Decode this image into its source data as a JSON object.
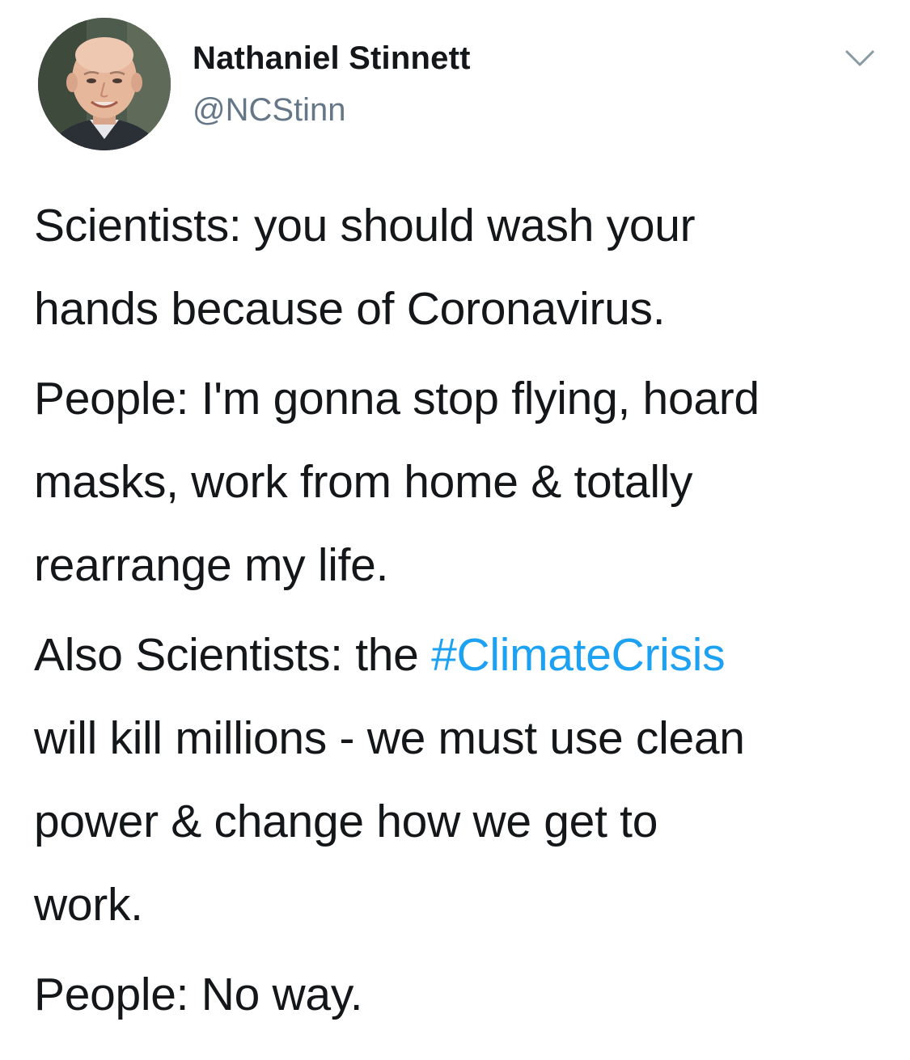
{
  "author": {
    "name": "Nathaniel Stinnett",
    "handle": "@NCStinn",
    "avatar_alt": "avatar"
  },
  "tweet": {
    "p1": "Scientists: you should wash your\nhands because of Coronavirus.",
    "p2": "People: I'm gonna stop flying, hoard\nmasks, work from home & totally\nrearrange my life.",
    "p3_before": "Also Scientists: the ",
    "p3_hashtag": "#ClimateCrisis",
    "p3_after": "\nwill kill millions - we must use clean\npower & change how we get to\nwork.",
    "p4": "People: No way."
  },
  "colors": {
    "text": "#14171a",
    "secondary": "#657786",
    "link": "#1da1f2"
  },
  "icons": {
    "menu": "chevron-down-icon"
  }
}
